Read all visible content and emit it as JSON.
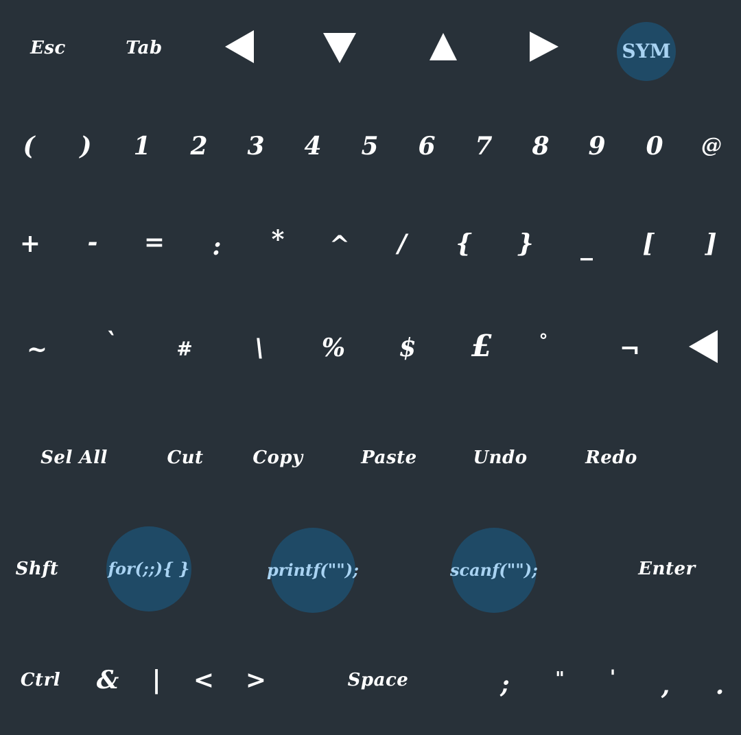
{
  "colors": {
    "background": "#283139",
    "key_text": "#ffffff",
    "bubble": "#1f4a66",
    "bubble_text": "#a9d3f2"
  },
  "row1": {
    "esc": "Esc",
    "tab": "Tab",
    "arrow_left": "left-arrow-icon",
    "arrow_down": "down-arrow-icon",
    "arrow_up": "up-arrow-icon",
    "arrow_right": "right-arrow-icon",
    "sym": "SYM"
  },
  "row2": [
    "(",
    ")",
    "1",
    "2",
    "3",
    "4",
    "5",
    "6",
    "7",
    "8",
    "9",
    "0",
    "@"
  ],
  "row3": [
    "+",
    "-",
    "=",
    ":",
    "*",
    "^",
    "/",
    "{",
    "}",
    "_",
    "[",
    "]"
  ],
  "row4": [
    "~",
    "`",
    "#",
    "\\",
    "%",
    "$",
    "£",
    "°",
    "¬"
  ],
  "row4_backspace": "backspace-arrow-icon",
  "row5": {
    "sel_all": "Sel All",
    "cut": "Cut",
    "copy": "Copy",
    "paste": "Paste",
    "undo": "Undo",
    "redo": "Redo"
  },
  "row6": {
    "shift": "Shft",
    "snippet_for": "for(;;){  }",
    "snippet_printf": "printf(\"\");",
    "snippet_scanf": "scanf(\"\");",
    "enter": "Enter"
  },
  "row7": {
    "ctrl": "Ctrl",
    "amp": "&",
    "pipe": "|",
    "lt": "<",
    "gt": ">",
    "space": "Space",
    "semicolon": ";",
    "dquote": "\"",
    "squote": "'",
    "comma": ",",
    "period": "."
  }
}
